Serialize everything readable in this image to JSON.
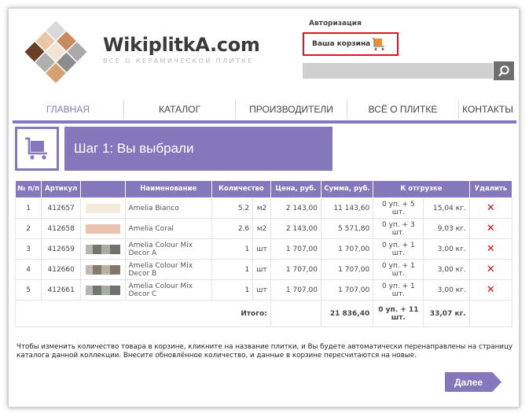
{
  "header": {
    "logo_text": "WikiplitkA.com",
    "tagline": "ВСЁ О КЕРАМИЧЕСКОЙ ПЛИТКЕ",
    "auth_label": "Авторизация",
    "cart_label": "Ваша корзина",
    "search_placeholder": ""
  },
  "nav": {
    "items": [
      {
        "label": "ГЛАВНАЯ"
      },
      {
        "label": "КАТАЛОГ"
      },
      {
        "label": "ПРОИЗВОДИТЕЛИ"
      },
      {
        "label": "ВСЁ О ПЛИТКЕ"
      },
      {
        "label": "КОНТАКТЫ"
      }
    ]
  },
  "step": {
    "title": "Шаг 1: Вы выбрали"
  },
  "table": {
    "headers": {
      "num": "№ п/п",
      "article": "Артикул",
      "image": "",
      "name": "Наименование",
      "quantity": "Количество",
      "price": "Цена, руб.",
      "sum": "Сумма, руб.",
      "shipment": "К отгрузке",
      "delete": "Удалить"
    },
    "rows": [
      {
        "num": "1",
        "article": "412657",
        "swatch": "#f3ecdc",
        "name": "Amelia Bianco",
        "qty": "5.2",
        "unit": "м2",
        "price": "2 143,00",
        "sum": "11 143,60",
        "ship": "0 уп. + 5 шт.",
        "weight": "15,04 кг.",
        "delete": "✕"
      },
      {
        "num": "2",
        "article": "412658",
        "swatch": "#ecc3b0",
        "name": "Amelia Coral",
        "qty": "2.6",
        "unit": "м2",
        "price": "2 143,00",
        "sum": "5 571,80",
        "ship": "0 уп. + 3 шт.",
        "weight": "9,03 кг.",
        "delete": "✕"
      },
      {
        "num": "3",
        "article": "412659",
        "swatch": "#8f8f86",
        "name": "Amelia Colour Mix Decor A",
        "qty": "1",
        "unit": "шт",
        "price": "1 707,00",
        "sum": "1 707,00",
        "ship": "0 уп. + 1 шт.",
        "weight": "3,00 кг.",
        "delete": "✕"
      },
      {
        "num": "4",
        "article": "412660",
        "swatch": "#a29486",
        "name": "Amelia Colour Mix Decor B",
        "qty": "1",
        "unit": "шт",
        "price": "1 707,00",
        "sum": "1 707,00",
        "ship": "0 уп. + 1 шт.",
        "weight": "3,00 кг.",
        "delete": "✕"
      },
      {
        "num": "5",
        "article": "412661",
        "swatch": "#8a8f87",
        "name": "Amelia Colour Mix Decor C",
        "qty": "1",
        "unit": "шт",
        "price": "1 707,00",
        "sum": "1 707,00",
        "ship": "0 уп. + 1 шт.",
        "weight": "3,00 кг.",
        "delete": "✕"
      }
    ],
    "total": {
      "label": "Итого:",
      "sum": "21 836,40",
      "ship": "0 уп. + 11 шт.",
      "weight": "33,07 кг."
    }
  },
  "note": "Чтобы изменить количество товара в корзине, кликните на название плитки, и Вы будете автоматически перенаправлены на страницу каталога данной коллекции. Внесите обновлённое количество, и данные в корзине пересчитаются на новые.",
  "next_label": "Далее",
  "colors": {
    "accent": "#8477bb",
    "cart_highlight": "#e0151f",
    "delete": "#cc1111"
  }
}
